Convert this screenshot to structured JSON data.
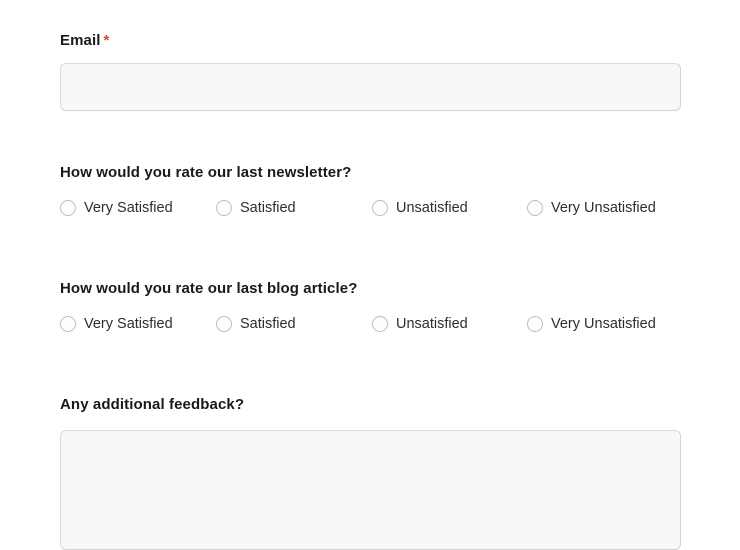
{
  "theme": {
    "background": "#ffffff",
    "required_marker_color": "#e8431f",
    "field_background": "#f8f8f8",
    "field_border": "#dcdcdc",
    "radio_border": "#bdbdbd",
    "label_color": "#1a1a1a",
    "option_text_color": "#2e2e2e"
  },
  "form": {
    "email": {
      "label": "Email",
      "required_marker": "*",
      "value": "",
      "placeholder": ""
    },
    "questions": [
      {
        "id": "newsletter",
        "label": "How would you rate our last newsletter?",
        "selected": null,
        "options": [
          {
            "label": "Very Satisfied"
          },
          {
            "label": "Satisfied"
          },
          {
            "label": "Unsatisfied"
          },
          {
            "label": "Very Unsatisfied"
          }
        ]
      },
      {
        "id": "blog",
        "label": "How would you rate our last blog article?",
        "selected": null,
        "options": [
          {
            "label": "Very Satisfied"
          },
          {
            "label": "Satisfied"
          },
          {
            "label": "Unsatisfied"
          },
          {
            "label": "Very Unsatisfied"
          }
        ]
      }
    ],
    "feedback": {
      "label": "Any additional feedback?",
      "value": "",
      "placeholder": ""
    }
  }
}
